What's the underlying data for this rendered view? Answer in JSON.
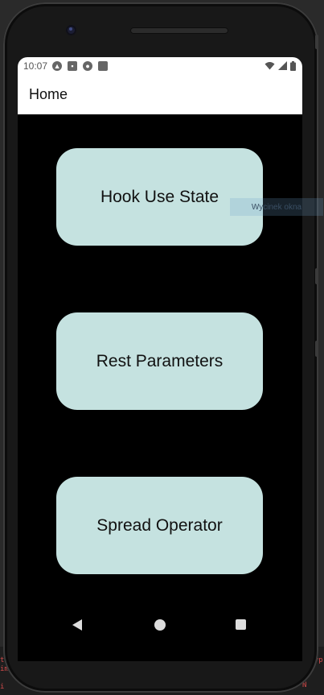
{
  "status_bar": {
    "time": "10:07",
    "icons": [
      "app-a-icon",
      "image-icon",
      "chrome-icon",
      "sd-card-icon"
    ],
    "right_icons": [
      "wifi-icon",
      "signal-icon",
      "battery-icon"
    ]
  },
  "app_bar": {
    "title": "Home"
  },
  "buttons": [
    {
      "label": "Hook Use State"
    },
    {
      "label": "Rest Parameters"
    },
    {
      "label": "Spread Operator"
    }
  ],
  "overlay": {
    "tooltip": "Wycinek okna"
  },
  "background_code": {
    "left_top": "t\nim",
    "right_top": "otyp",
    "left_bottom": "i",
    "right_bottom": "N"
  },
  "colors": {
    "button_bg": "#c5e2e0",
    "screen_bg": "#000000",
    "appbar_bg": "#ffffff"
  },
  "system_nav": {
    "icons": [
      "back-icon",
      "home-icon",
      "recents-icon"
    ]
  }
}
